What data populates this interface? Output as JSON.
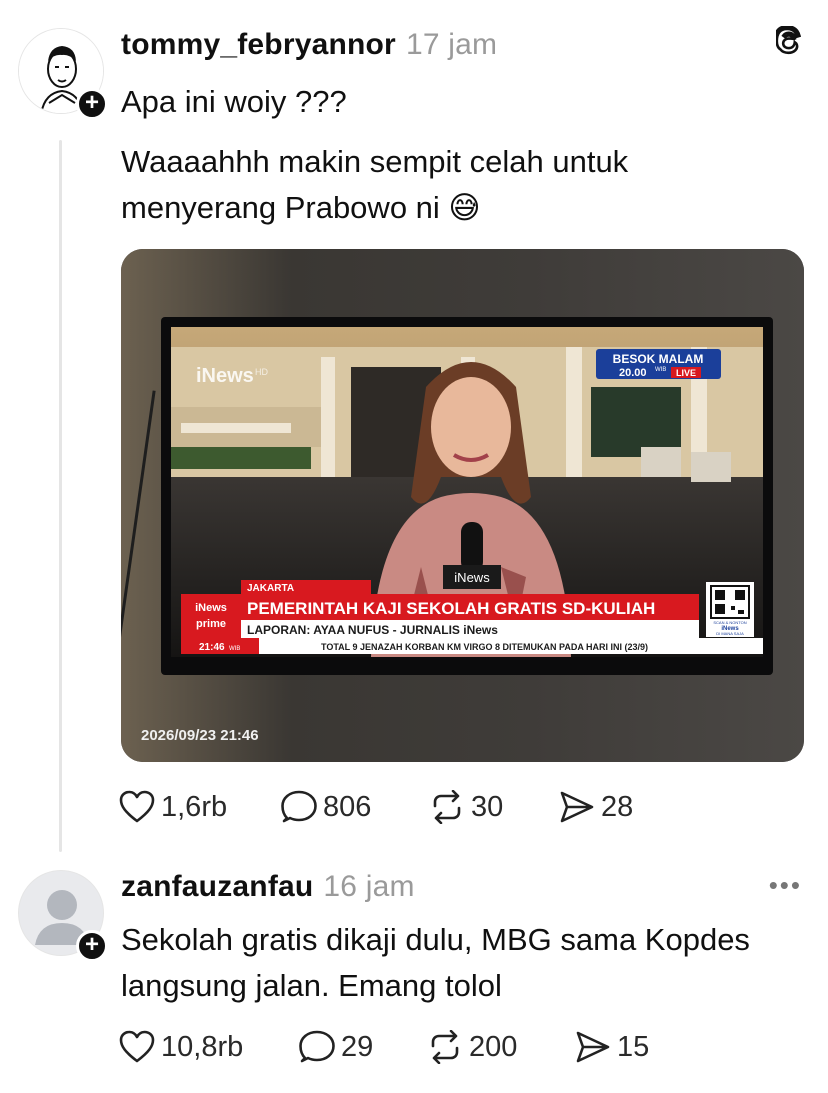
{
  "post": {
    "username": "tommy_febryannor",
    "time": "17 jam",
    "line1": "Apa ini woiy ???",
    "line2": "Waaaahhh makin sempit celah untuk",
    "line3": "menyerang Prabowo ni 😅",
    "media": {
      "tv": {
        "channel_logo": "iNews",
        "channel_hd": "HD",
        "promo_top": "BESOK MALAM",
        "promo_time": "20.00",
        "promo_wib": "WIB",
        "promo_live": "LIVE",
        "location": "JAKARTA",
        "headline": "PEMERINTAH KAJI SEKOLAH GRATIS SD-KULIAH",
        "report": "LAPORAN: AYAA NUFUS - JURNALIS iNews",
        "program_logo_1": "iNews",
        "program_logo_2": "prime",
        "clock": "21:46",
        "clock_wib": "WIB",
        "ticker": "TOTAL 9 JENAZAH KORBAN KM VIRGO 8 DITEMUKAN PADA HARI INI (23/9)",
        "mic_label": "iNews",
        "qr_line1": "SCAN & NONTON",
        "qr_line2": "iNews",
        "qr_line3": "DI MANA SAJA"
      },
      "timestamp": "2026/09/23 21:46"
    },
    "likes": "1,6rb",
    "replies": "806",
    "reposts": "30",
    "shares": "28"
  },
  "reply": {
    "username": "zanfauzanfau",
    "time": "16 jam",
    "line1": "Sekolah gratis dikaji dulu, MBG sama Kopdes",
    "line2": "langsung jalan. Emang tolol",
    "likes": "10,8rb",
    "replies": "29",
    "reposts": "200",
    "shares": "15",
    "more": "•••"
  },
  "icons": {
    "threads_logo": "threads-logo-icon",
    "follow": "plus-icon",
    "like": "heart-icon",
    "reply": "comment-icon",
    "repost": "repost-icon",
    "share": "send-icon"
  },
  "colors": {
    "text": "#101010",
    "muted": "#9a9a9a",
    "news_red": "#d8191f",
    "news_blue": "#1b3f9a"
  }
}
